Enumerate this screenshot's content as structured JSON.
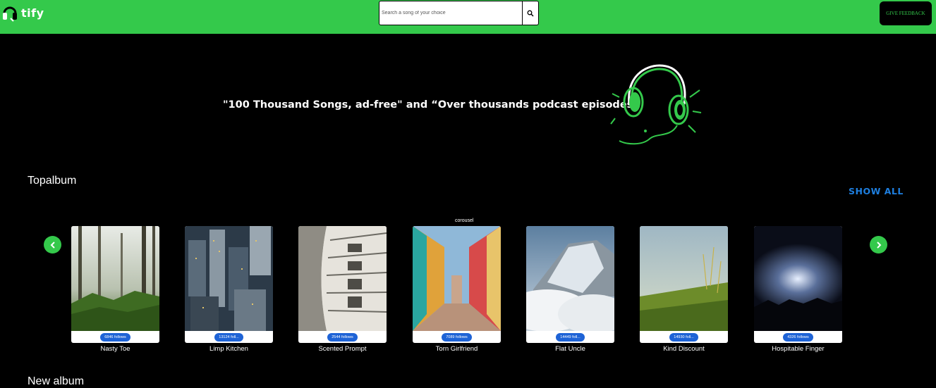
{
  "navbar": {
    "logo_text": "tify",
    "search_placeholder": "Search a song of your choice",
    "feedback_label": "GIVE FEEDBACK"
  },
  "hero": {
    "tagline": "\"100 Thousand Songs, ad-free\" and “Over thousands podcast episodes”",
    "art_icon": "headphones-illustration"
  },
  "section": {
    "title": "Topalbum",
    "show_all": "SHOW ALL",
    "carousel_label": "corousel",
    "next_section_title": "New album"
  },
  "albums": [
    {
      "name": "Nasty Toe",
      "follows": "6846 follows"
    },
    {
      "name": "Limp Kitchen",
      "follows": "13124 foll..."
    },
    {
      "name": "Scented Prompt",
      "follows": "2544 follows"
    },
    {
      "name": "Torn Girlfriend",
      "follows": "7089 follows"
    },
    {
      "name": "Flat Uncle",
      "follows": "14449 foll..."
    },
    {
      "name": "Kind Discount",
      "follows": "14930 foll..."
    },
    {
      "name": "Hospitable Finger",
      "follows": "4326 follows"
    }
  ],
  "colors": {
    "brand_green": "#34C94B",
    "accent_blue": "#1E7FE0",
    "chip_blue": "#1E63D6",
    "background": "#000000"
  }
}
